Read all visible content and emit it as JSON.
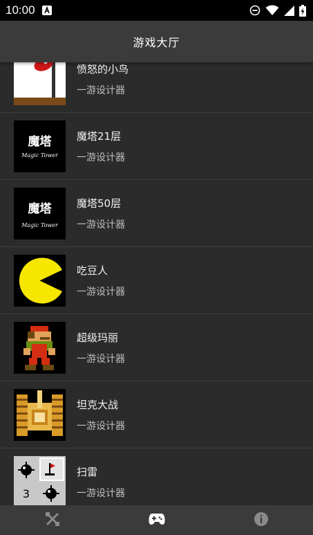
{
  "status_bar": {
    "time": "10:00",
    "icons": [
      "notification-a-icon",
      "do-not-disturb-icon",
      "wifi-icon",
      "signal-icon",
      "battery-charging-icon"
    ]
  },
  "app_bar": {
    "title": "游戏大厅"
  },
  "games": [
    {
      "name": "愤怒的小鸟",
      "subtitle": "一游设计器",
      "icon": "angry-bird-thumbnail"
    },
    {
      "name": "魔塔21层",
      "subtitle": "一游设计器",
      "icon": "magic-tower-thumbnail",
      "thumb_text": "魔塔",
      "thumb_caption": "Magic Tower"
    },
    {
      "name": "魔塔50层",
      "subtitle": "一游设计器",
      "icon": "magic-tower-50-thumbnail",
      "thumb_text": "魔塔",
      "thumb_caption": "Magic Tower"
    },
    {
      "name": "吃豆人",
      "subtitle": "一游设计器",
      "icon": "pacman-thumbnail"
    },
    {
      "name": "超级玛丽",
      "subtitle": "一游设计器",
      "icon": "mario-thumbnail"
    },
    {
      "name": "坦克大战",
      "subtitle": "一游设计器",
      "icon": "tank-thumbnail"
    },
    {
      "name": "扫雷",
      "subtitle": "一游设计器",
      "icon": "minesweeper-thumbnail",
      "thumb_number": "3"
    }
  ],
  "bottom_nav": [
    {
      "id": "tools",
      "icon": "tools-icon",
      "active": false
    },
    {
      "id": "games",
      "icon": "gamepad-icon",
      "active": true
    },
    {
      "id": "info",
      "icon": "info-icon",
      "active": false
    }
  ],
  "colors": {
    "background": "#2b2b2b",
    "app_bar": "#3b3b3b",
    "divider": "#3e3e3e",
    "subtitle": "#bdbdbd"
  }
}
